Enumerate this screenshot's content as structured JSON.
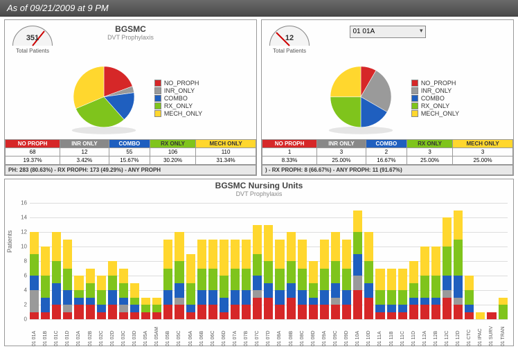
{
  "header_text": "As of 09/21/2009 at 9 PM",
  "colors": {
    "no_proph": "#d62728",
    "inr_only": "#9a9a9a",
    "combo": "#1f5fbf",
    "rx_only": "#7fc41c",
    "mech_only": "#ffd72e"
  },
  "legend": [
    {
      "label": "NO_PROPH",
      "key": "no_proph"
    },
    {
      "label": "INR_ONLY",
      "key": "inr_only"
    },
    {
      "label": "COMBO",
      "key": "combo"
    },
    {
      "label": "RX_ONLY",
      "key": "rx_only"
    },
    {
      "label": "MECH_ONLY",
      "key": "mech_only"
    }
  ],
  "left": {
    "gauge_value": "351",
    "gauge_label": "Total Patients",
    "title": "BGSMC",
    "subtitle": "DVT Prophylaxis",
    "table_headers": [
      "NO PROPH",
      "INR ONLY",
      "COMBO",
      "RX ONLY",
      "MECH ONLY"
    ],
    "counts": [
      "68",
      "12",
      "55",
      "106",
      "110"
    ],
    "percents": [
      "19.37%",
      "3.42%",
      "15.67%",
      "30.20%",
      "31.34%"
    ],
    "summary": "PH: 283 (80.63%)    -    RX PROPH: 173 (49.29%)    -    ANY PROPH"
  },
  "right": {
    "gauge_value": "12",
    "gauge_label": "Total Patients",
    "dropdown_selected": "01 01A",
    "table_headers": [
      "NO PROPH",
      "INR ONLY",
      "COMBO",
      "RX ONLY",
      "MECH ONLY"
    ],
    "counts": [
      "1",
      "3",
      "2",
      "3",
      "3"
    ],
    "percents": [
      "8.33%",
      "25.00%",
      "16.67%",
      "25.00%",
      "25.00%"
    ],
    "summary": ")    -    RX PROPH: 8 (66.67%)    -    ANY PROPH: 11 (91.67%)"
  },
  "chart_data": [
    {
      "type": "pie",
      "title": "BGSMC — DVT Prophylaxis",
      "series": [
        {
          "name": "NO_PROPH",
          "value": 68,
          "pct": 19.37
        },
        {
          "name": "INR_ONLY",
          "value": 12,
          "pct": 3.42
        },
        {
          "name": "COMBO",
          "value": 55,
          "pct": 15.67
        },
        {
          "name": "RX_ONLY",
          "value": 106,
          "pct": 30.2
        },
        {
          "name": "MECH_ONLY",
          "value": 110,
          "pct": 31.34
        }
      ],
      "total": 351
    },
    {
      "type": "pie",
      "title": "01 01A — DVT Prophylaxis",
      "series": [
        {
          "name": "NO_PROPH",
          "value": 1,
          "pct": 8.33
        },
        {
          "name": "INR_ONLY",
          "value": 3,
          "pct": 25.0
        },
        {
          "name": "COMBO",
          "value": 2,
          "pct": 16.67
        },
        {
          "name": "RX_ONLY",
          "value": 3,
          "pct": 25.0
        },
        {
          "name": "MECH_ONLY",
          "value": 3,
          "pct": 25.0
        }
      ],
      "total": 12
    },
    {
      "type": "bar",
      "stacked": true,
      "title": "BGSMC Nursing Units",
      "subtitle": "DVT Prophylaxis",
      "ylabel": "Patients",
      "ylim": [
        0,
        16
      ],
      "yticks": [
        0,
        2,
        4,
        6,
        8,
        10,
        12,
        14,
        16
      ],
      "stack_order": [
        "no_proph",
        "inr_only",
        "combo",
        "rx_only",
        "mech_only"
      ],
      "categories": [
        "01 01A",
        "01 01B",
        "01 01C",
        "01 01D",
        "01 02A",
        "01 02B",
        "01 02C",
        "01 02D",
        "01 03C",
        "01 03D",
        "01 05A",
        "01 05AM",
        "01 05B",
        "01 05C",
        "01 06A",
        "01 06B",
        "01 06C",
        "01 06D",
        "01 07A",
        "01 07B",
        "01 07C",
        "01 07D",
        "01 08A",
        "01 08B",
        "01 08C",
        "01 08D",
        "01 09A",
        "01 09C",
        "01 09D",
        "01 10A",
        "01 10D",
        "01 11A",
        "01 11B",
        "01 11C",
        "01 11D",
        "01 12A",
        "01 12B",
        "01 12C",
        "01 12D",
        "01 CTC",
        "01 IPAC",
        "01 SURV",
        "01 TRAN"
      ],
      "series": [
        {
          "name": "no_proph",
          "values": [
            1,
            1,
            2,
            1,
            2,
            2,
            1,
            2,
            1,
            1,
            1,
            1,
            2,
            2,
            1,
            2,
            2,
            1,
            2,
            2,
            3,
            3,
            2,
            3,
            2,
            2,
            2,
            2,
            2,
            4,
            3,
            1,
            1,
            1,
            2,
            2,
            2,
            3,
            2,
            1,
            0,
            1,
            0
          ]
        },
        {
          "name": "inr_only",
          "values": [
            3,
            0,
            0,
            1,
            0,
            0,
            0,
            0,
            1,
            0,
            0,
            0,
            0,
            1,
            0,
            0,
            0,
            0,
            0,
            0,
            1,
            0,
            0,
            0,
            0,
            0,
            0,
            1,
            0,
            2,
            0,
            0,
            0,
            0,
            0,
            0,
            0,
            1,
            1,
            0,
            0,
            0,
            0
          ]
        },
        {
          "name": "combo",
          "values": [
            2,
            2,
            3,
            2,
            1,
            1,
            1,
            2,
            1,
            1,
            0,
            0,
            2,
            2,
            1,
            2,
            2,
            2,
            2,
            2,
            2,
            2,
            2,
            2,
            2,
            1,
            2,
            2,
            2,
            3,
            2,
            1,
            1,
            1,
            1,
            1,
            1,
            2,
            3,
            1,
            0,
            0,
            0
          ]
        },
        {
          "name": "rx_only",
          "values": [
            3,
            3,
            3,
            3,
            1,
            2,
            2,
            2,
            2,
            1,
            1,
            1,
            3,
            3,
            3,
            3,
            3,
            3,
            3,
            3,
            3,
            3,
            3,
            3,
            3,
            2,
            3,
            3,
            3,
            3,
            3,
            2,
            2,
            2,
            2,
            3,
            3,
            4,
            5,
            2,
            0,
            0,
            2
          ]
        },
        {
          "name": "mech_only",
          "values": [
            3,
            4,
            4,
            4,
            2,
            2,
            2,
            2,
            2,
            2,
            1,
            1,
            4,
            4,
            4,
            4,
            4,
            5,
            4,
            4,
            4,
            5,
            4,
            4,
            4,
            3,
            4,
            4,
            4,
            3,
            4,
            3,
            3,
            3,
            3,
            4,
            4,
            4,
            4,
            2,
            1,
            0,
            1
          ]
        }
      ]
    }
  ],
  "bottom": {
    "title": "BGSMC Nursing Units",
    "subtitle": "DVT Prophylaxis",
    "ylabel": "Patients"
  }
}
